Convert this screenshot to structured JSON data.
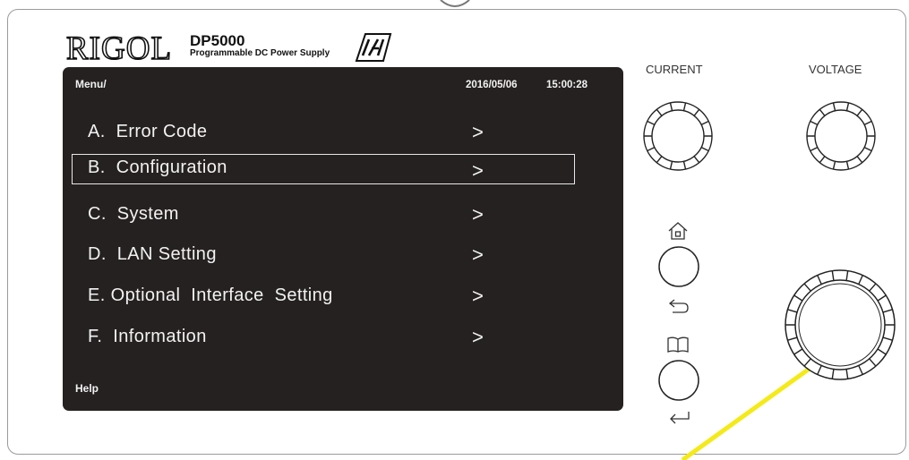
{
  "brand": {
    "logo": "RIGOL",
    "model": "DP5000",
    "subtitle": "Programmable DC Power Supply",
    "lxi": "LXI"
  },
  "screen": {
    "path": "Menu/",
    "date": "2016/05/06",
    "time": "15:00:28",
    "help": "Help",
    "items": [
      {
        "label": "A.  Error Code",
        "arrow": ">"
      },
      {
        "label": "B.  Configuration",
        "arrow": ">",
        "selected": true
      },
      {
        "label": "C.  System",
        "arrow": ">"
      },
      {
        "label": "D.  LAN Setting",
        "arrow": ">"
      },
      {
        "label": "E. Optional  Interface  Setting",
        "arrow": ">"
      },
      {
        "label": "F.  Information",
        "arrow": ">"
      }
    ]
  },
  "controls": {
    "current_label": "CURRENT",
    "voltage_label": "VOLTAGE"
  },
  "colors": {
    "screen_bg": "#252120",
    "pointer": "#f4ea1a"
  }
}
